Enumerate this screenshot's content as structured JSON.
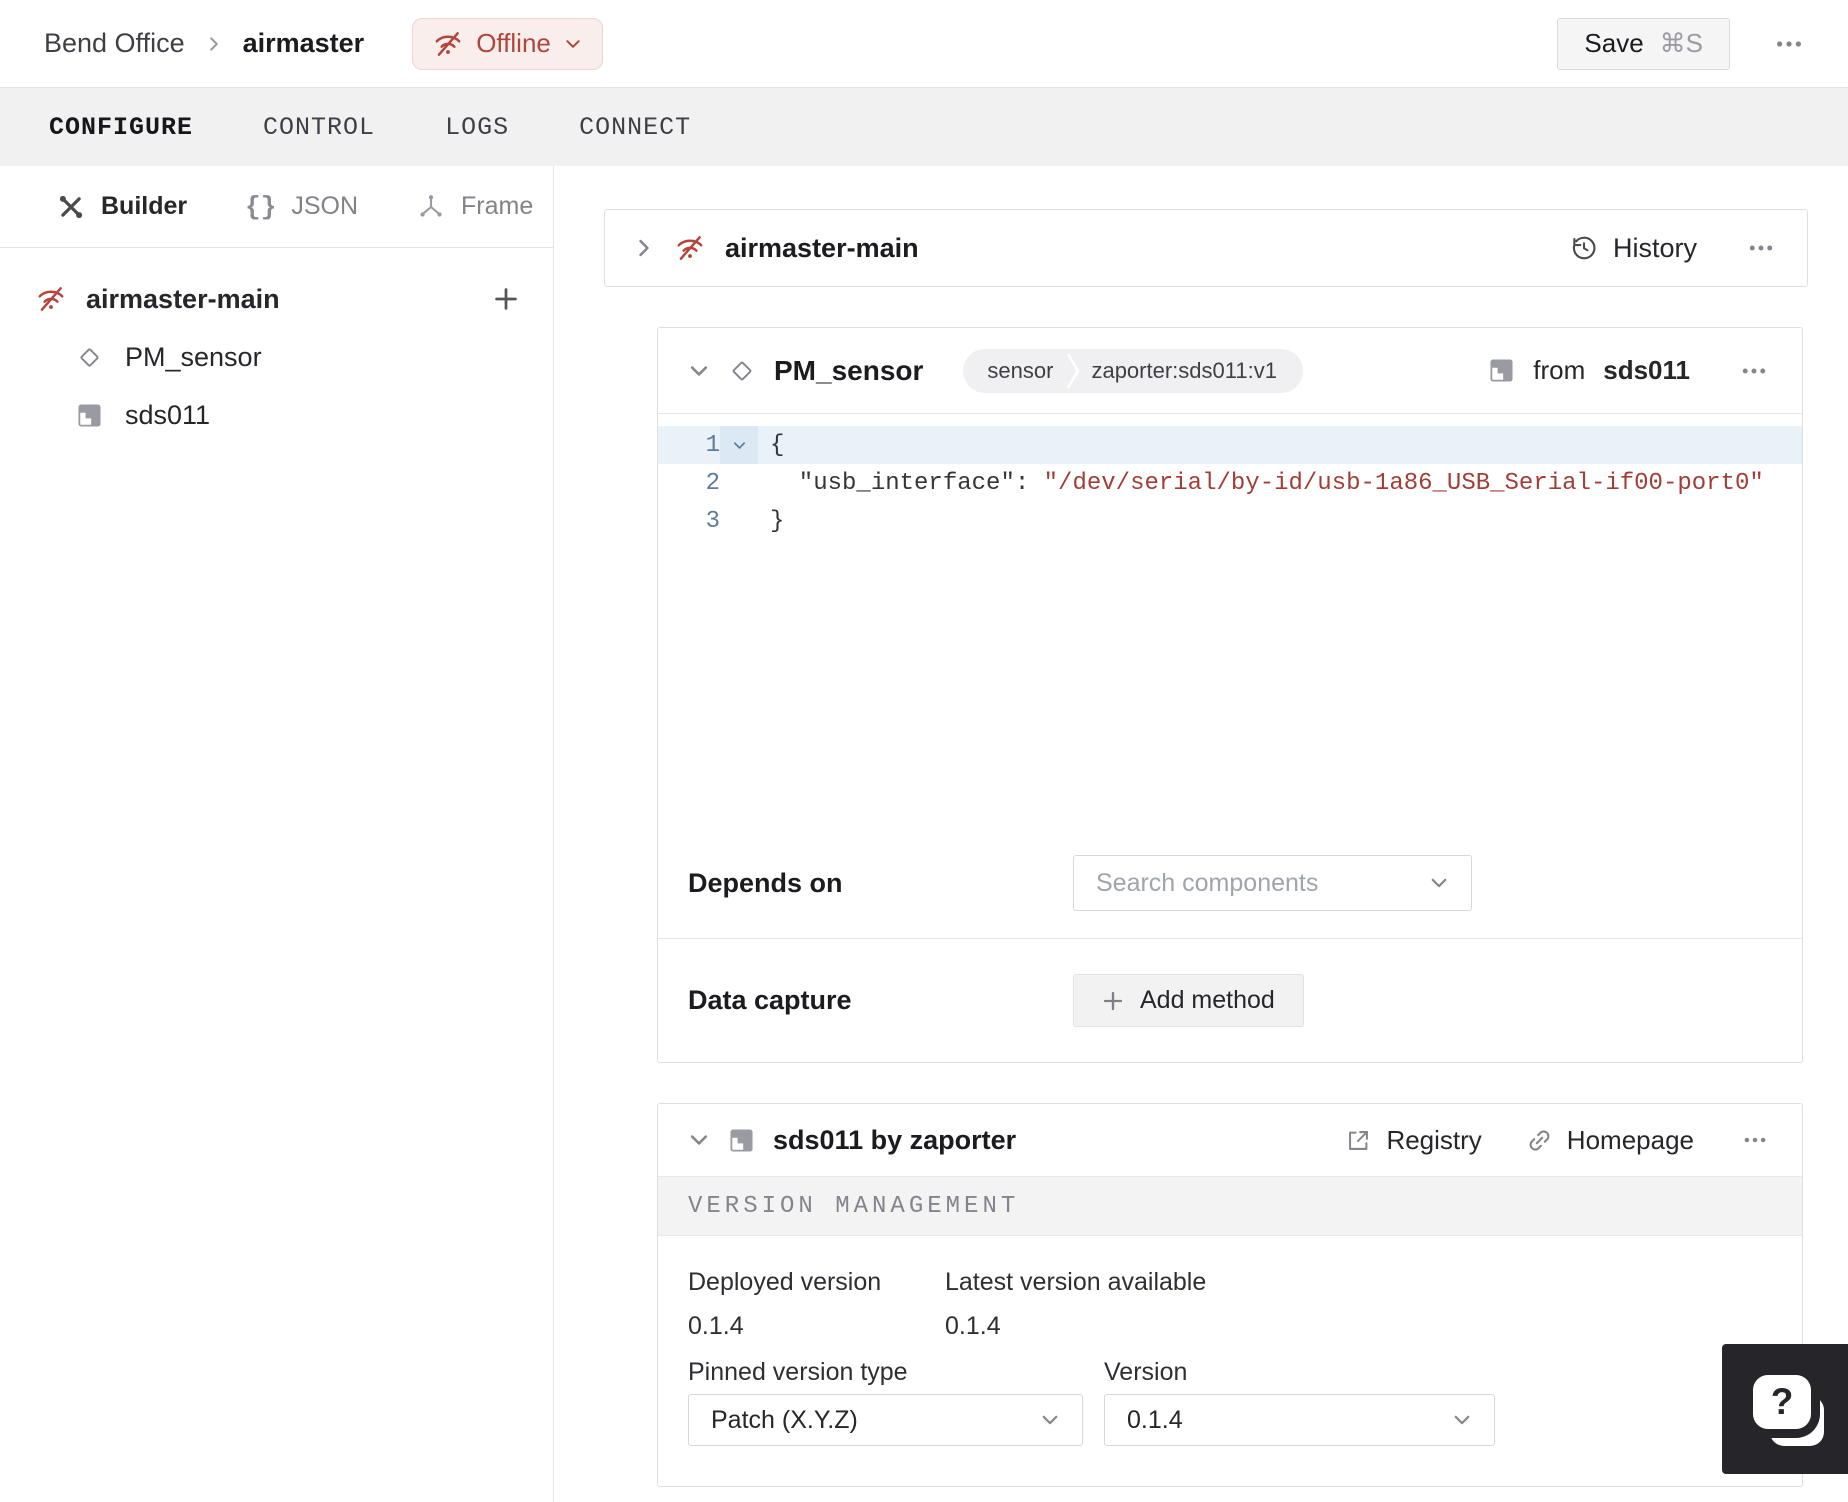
{
  "header": {
    "breadcrumb_location": "Bend Office",
    "breadcrumb_machine": "airmaster",
    "status_label": "Offline",
    "save_label": "Save",
    "save_shortcut": "⌘S"
  },
  "tabs": [
    {
      "label": "CONFIGURE",
      "active": true
    },
    {
      "label": "CONTROL",
      "active": false
    },
    {
      "label": "LOGS",
      "active": false
    },
    {
      "label": "CONNECT",
      "active": false
    }
  ],
  "sidebar": {
    "modes": [
      {
        "label": "Builder",
        "icon": "tools-icon",
        "active": true
      },
      {
        "label": "JSON",
        "icon": "braces-icon",
        "glyph": "{}",
        "active": false
      },
      {
        "label": "Frame",
        "icon": "frame-icon",
        "active": false
      }
    ],
    "tree": [
      {
        "label": "airmaster-main",
        "icon": "wifi-off-icon"
      },
      {
        "label": "PM_sensor",
        "icon": "diamond-icon"
      },
      {
        "label": "sds011",
        "icon": "module-icon"
      }
    ]
  },
  "main": {
    "machine": {
      "title": "airmaster-main",
      "history_label": "History"
    },
    "component": {
      "title": "PM_sensor",
      "type_badge": "sensor",
      "model_badge": "zaporter:sds011:v1",
      "from_label": "from",
      "from_target": "sds011",
      "code": {
        "line1": {
          "num": "1",
          "text": "{"
        },
        "line2": {
          "num": "2",
          "key": "  \"usb_interface\": ",
          "value": "\"/dev/serial/by-id/usb-1a86_USB_Serial-if00-port0\""
        },
        "line3": {
          "num": "3",
          "text": "}"
        }
      },
      "depends_label": "Depends on",
      "depends_placeholder": "Search components",
      "capture_label": "Data capture",
      "capture_button": "Add method"
    },
    "module": {
      "title": "sds011 by zaporter",
      "registry_label": "Registry",
      "homepage_label": "Homepage",
      "section_title": "VERSION MANAGEMENT",
      "deployed_label": "Deployed version",
      "deployed_value": "0.1.4",
      "latest_label": "Latest version available",
      "latest_value": "0.1.4",
      "pinned_label": "Pinned version type",
      "pinned_value": "Patch (X.Y.Z)",
      "version_label": "Version",
      "version_value": "0.1.4"
    }
  },
  "help": {
    "glyph": "?"
  },
  "colors": {
    "accent_red": "#B0453C",
    "offline_badge_bg": "#F9EEEC",
    "code_string": "#A33E37",
    "line_number": "#5E7C9B",
    "active_line_bg": "#E9F1F9",
    "tabbar_bg": "#F1F1F2",
    "help_fab_bg": "#26262A"
  }
}
